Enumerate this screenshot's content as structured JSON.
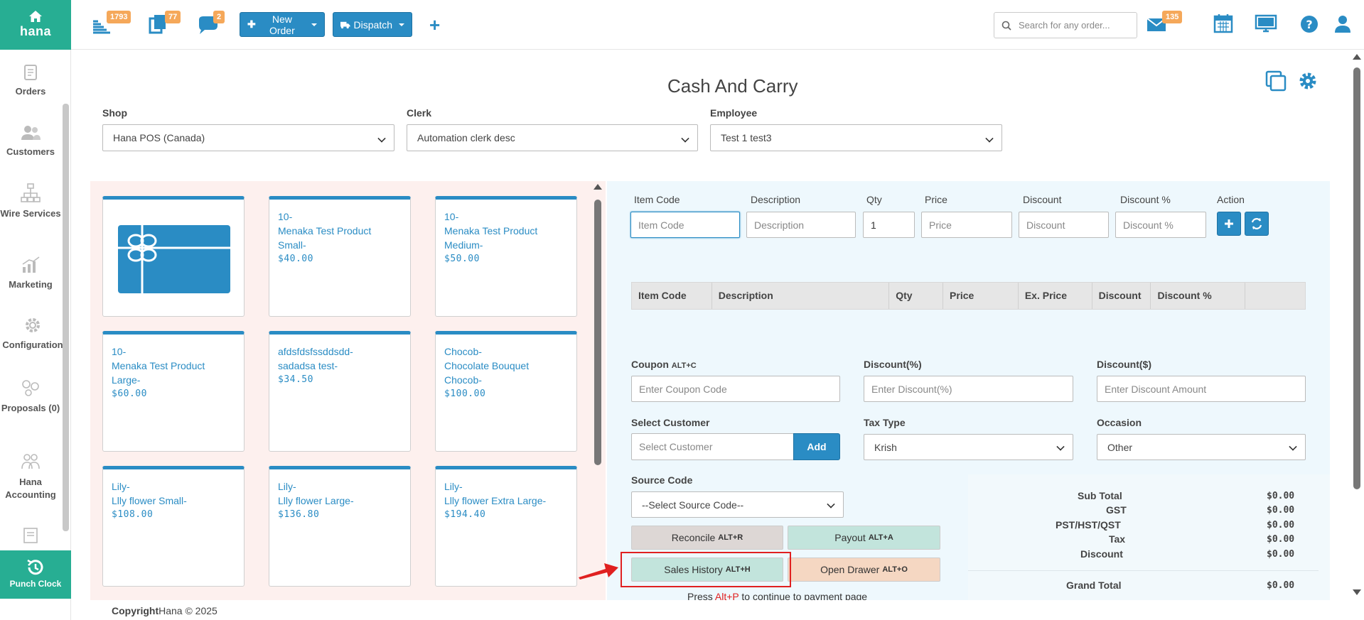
{
  "app": {
    "brand": "hana",
    "title": "Cash And Carry"
  },
  "topbar": {
    "badges": {
      "orders": "1793",
      "copies": "77",
      "chat": "2",
      "mail": "135"
    },
    "new_order_label": "New Order",
    "dispatch_label": "Dispatch",
    "search_placeholder": "Search for any order..."
  },
  "sidebar": {
    "items": [
      {
        "label": "Orders",
        "icon": "orders-icon"
      },
      {
        "label": "Customers",
        "icon": "customers-icon"
      },
      {
        "label": "Wire Services",
        "icon": "wire-services-icon"
      },
      {
        "label": "Marketing",
        "icon": "marketing-icon"
      },
      {
        "label": "Configuration",
        "icon": "configuration-icon"
      },
      {
        "label": "Proposals (0)",
        "icon": "proposals-icon"
      },
      {
        "label": "Hana Accounting",
        "icon": "accounting-icon"
      }
    ],
    "punch_clock": "Punch Clock"
  },
  "filters": {
    "shop_label": "Shop",
    "shop_value": "Hana POS (Canada)",
    "clerk_label": "Clerk",
    "clerk_value": "Automation clerk desc",
    "employee_label": "Employee",
    "employee_value": "Test 1 test3"
  },
  "products": [
    {
      "type": "gift-card"
    },
    {
      "line1": "10-",
      "line2": "Menaka Test Product",
      "line3": "Small-",
      "price": "$40.00"
    },
    {
      "line1": "10-",
      "line2": "Menaka Test Product",
      "line3": "Medium-",
      "price": "$50.00"
    },
    {
      "line1": "10-",
      "line2": "Menaka Test Product",
      "line3": "Large-",
      "price": "$60.00"
    },
    {
      "line1": "afdsfdsfssddsdd-",
      "line2": "sadadsa test-",
      "line3": "",
      "price": "$34.50"
    },
    {
      "line1": "Chocob-",
      "line2": "Chocolate Bouquet",
      "line3": "Chocob-",
      "price": "$100.00"
    },
    {
      "line1": "Lily-",
      "line2": "Llly flower Small-",
      "line3": "",
      "price": "$108.00"
    },
    {
      "line1": "Lily-",
      "line2": "Llly flower Large-",
      "line3": "",
      "price": "$136.80"
    },
    {
      "line1": "Lily-",
      "line2": "Llly flower Extra Large-",
      "line3": "",
      "price": "$194.40"
    }
  ],
  "entry": {
    "labels": {
      "item_code": "Item Code",
      "description": "Description",
      "qty": "Qty",
      "price": "Price",
      "discount": "Discount",
      "discount_pct": "Discount %",
      "action": "Action"
    },
    "placeholders": {
      "item_code": "Item Code",
      "description": "Description",
      "price": "Price",
      "discount": "Discount",
      "discount_pct": "Discount %"
    },
    "qty_value": "1"
  },
  "grid_headers": [
    "Item Code",
    "Description",
    "Qty",
    "Price",
    "Ex. Price",
    "Discount",
    "Discount %",
    ""
  ],
  "coupon": {
    "label": "Coupon",
    "shortcut": "ALT+C",
    "placeholder": "Enter Coupon Code"
  },
  "discount_pct": {
    "label": "Discount(%)",
    "placeholder": "Enter Discount(%)"
  },
  "discount_amt": {
    "label": "Discount($)",
    "placeholder": "Enter Discount Amount"
  },
  "customer": {
    "label": "Select Customer",
    "placeholder": "Select Customer",
    "add_label": "Add"
  },
  "tax_type": {
    "label": "Tax Type",
    "value": "Krish"
  },
  "occasion": {
    "label": "Occasion",
    "value": "Other"
  },
  "source_code": {
    "label": "Source Code",
    "value": "--Select Source Code--"
  },
  "actions": {
    "reconcile": "Reconcile",
    "reconcile_key": "ALT+R",
    "payout": "Payout",
    "payout_key": "ALT+A",
    "sales_history": "Sales History",
    "sales_history_key": "ALT+H",
    "open_drawer": "Open Drawer",
    "open_drawer_key": "ALT+O"
  },
  "totals": {
    "sub_total_label": "Sub Total",
    "sub_total": "$0.00",
    "gst_label": "GST",
    "gst": "$0.00",
    "pst_label": "PST/HST/QST",
    "pst": "$0.00",
    "tax_label": "Tax",
    "tax": "$0.00",
    "discount_label": "Discount",
    "discount": "$0.00",
    "grand_total_label": "Grand Total",
    "grand_total": "$0.00"
  },
  "press_note": {
    "pre": "Press ",
    "key": "Alt+P",
    "post": " to continue to payment page"
  },
  "footer": {
    "copyright": "Copyright",
    "text": "Hana © 2025"
  },
  "colors": {
    "accent": "#2a8cc4",
    "brand_green": "#27ae93",
    "badge": "#f5a85a",
    "highlight": "#e02020"
  }
}
